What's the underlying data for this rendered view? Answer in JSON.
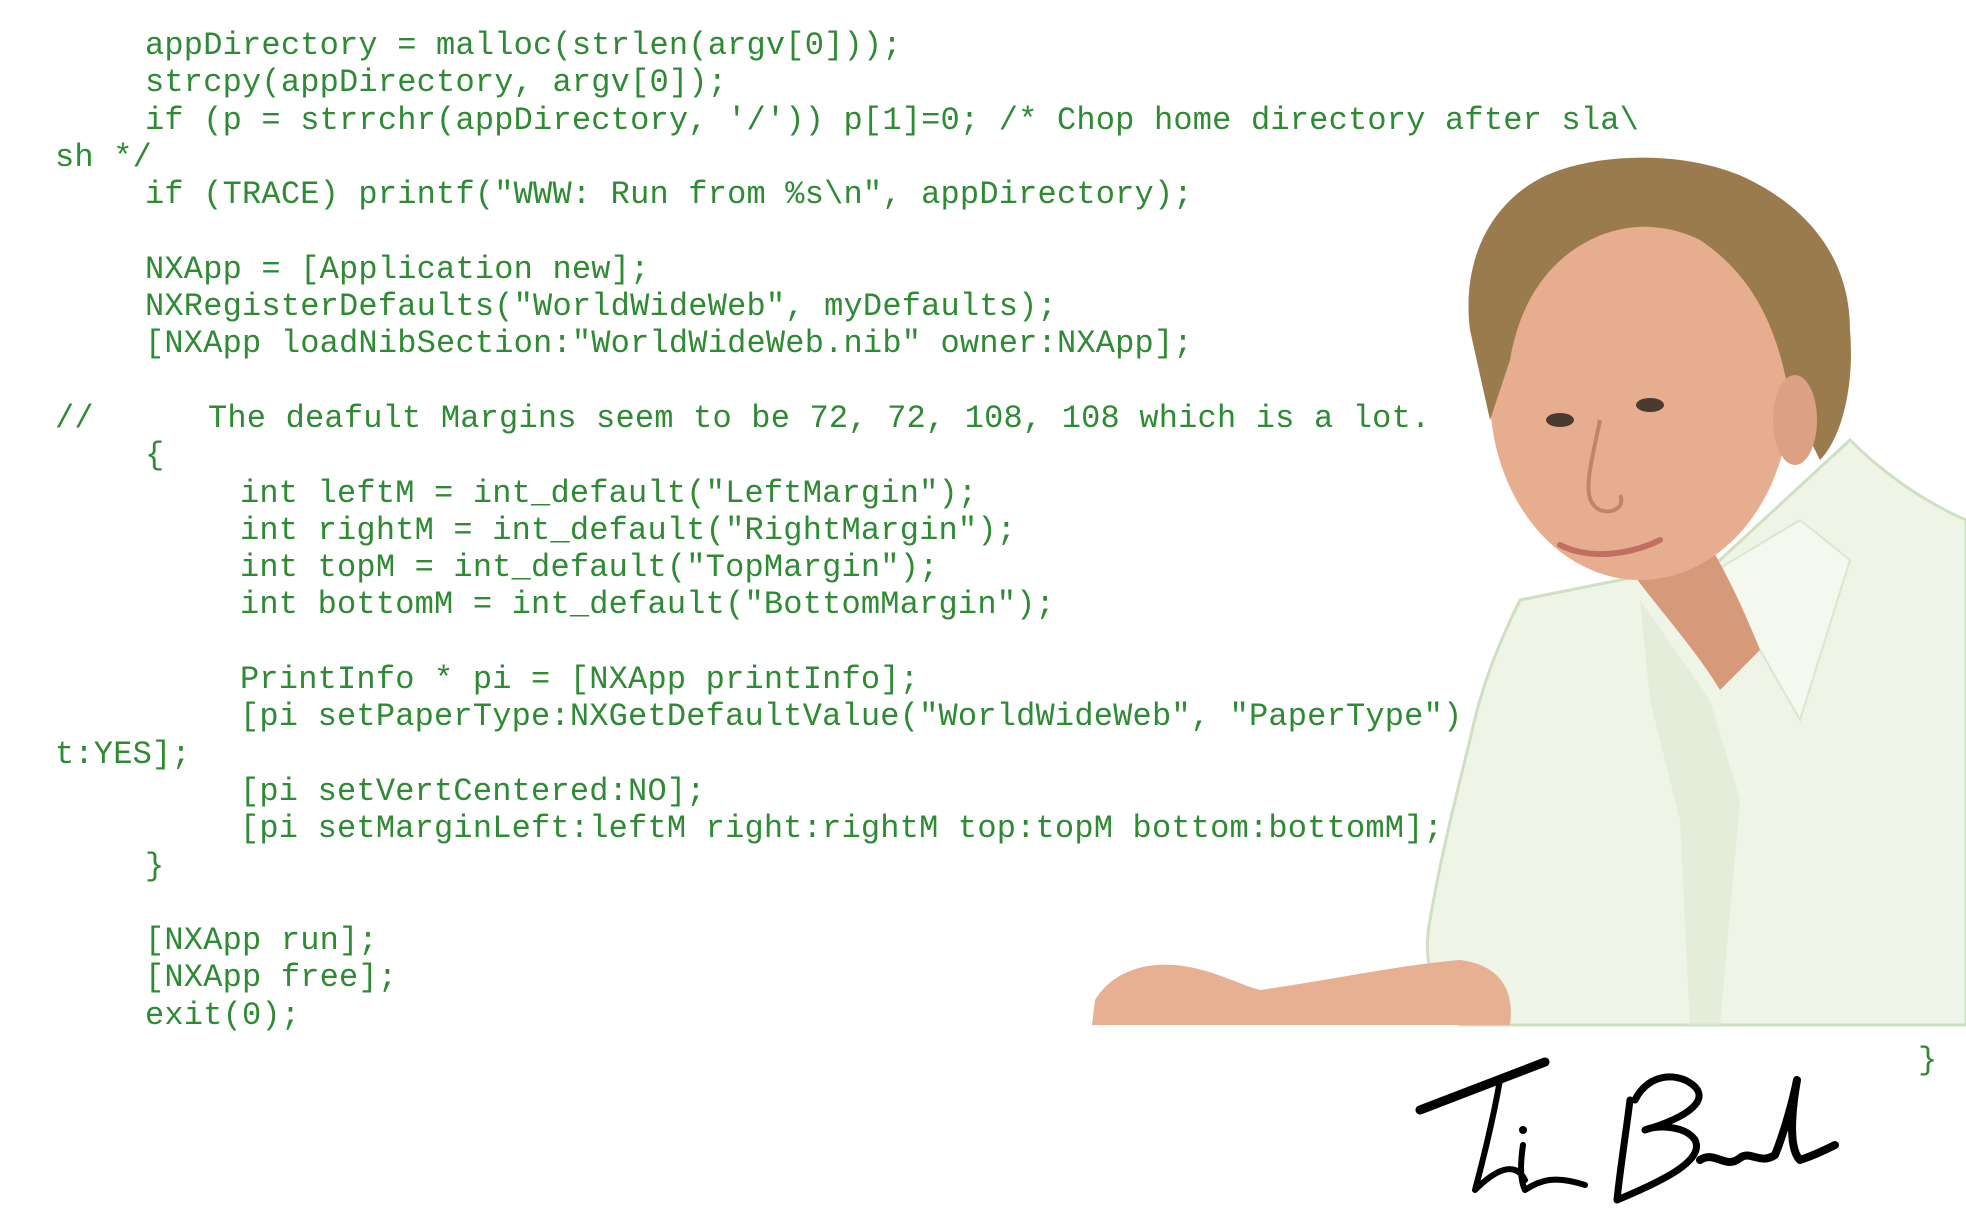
{
  "code": {
    "color": "#2f8a34",
    "lines": [
      {
        "indent": "i1",
        "text": "appDirectory = malloc(strlen(argv[0]));"
      },
      {
        "indent": "i1",
        "text": "strcpy(appDirectory, argv[0]);"
      },
      {
        "indent": "i1",
        "text": "if (p = strrchr(appDirectory, '/')) p[1]=0; /* Chop home directory after sla\\"
      },
      {
        "indent": "i0",
        "text": "sh */"
      },
      {
        "indent": "i1",
        "text": "if (TRACE) printf(\"WWW: Run from %s\\n\", appDirectory);"
      },
      {
        "indent": "i1",
        "text": ""
      },
      {
        "indent": "i1",
        "text": "NXApp = [Application new];"
      },
      {
        "indent": "i1",
        "text": "NXRegisterDefaults(\"WorldWideWeb\", myDefaults);"
      },
      {
        "indent": "i1",
        "text": "[NXApp loadNibSection:\"WorldWideWeb.nib\" owner:NXApp];"
      },
      {
        "indent": "i1",
        "text": ""
      },
      {
        "indent": "i0",
        "text": "//",
        "extra": "The deafult Margins seem to be 72, 72, 108, 108 which is a lot."
      },
      {
        "indent": "i1",
        "text": "{"
      },
      {
        "indent": "i2",
        "text": "int leftM = int_default(\"LeftMargin\");"
      },
      {
        "indent": "i2",
        "text": "int rightM = int_default(\"RightMargin\");"
      },
      {
        "indent": "i2",
        "text": "int topM = int_default(\"TopMargin\");"
      },
      {
        "indent": "i2",
        "text": "int bottomM = int_default(\"BottomMargin\");"
      },
      {
        "indent": "i2",
        "text": ""
      },
      {
        "indent": "i2",
        "text": "PrintInfo * pi = [NXApp printInfo];"
      },
      {
        "indent": "i2",
        "text": "[pi setPaperType:NXGetDefaultValue(\"WorldWideWeb\", \"PaperType\") a"
      },
      {
        "indent": "i0",
        "text": "t:YES];"
      },
      {
        "indent": "i2",
        "text": "[pi setVertCentered:NO];"
      },
      {
        "indent": "i2",
        "text": "[pi setMarginLeft:leftM right:rightM top:topM bottom:bottomM];"
      },
      {
        "indent": "i1",
        "text": "}"
      },
      {
        "indent": "i1",
        "text": ""
      },
      {
        "indent": "i1",
        "text": "[NXApp run];"
      },
      {
        "indent": "i1",
        "text": "[NXApp free];"
      },
      {
        "indent": "i1",
        "text": "exit(0);"
      }
    ],
    "closing_brace": "}"
  },
  "photo": {
    "subject": "portrait-photo",
    "skin": "#e2a98c",
    "skin_shade": "#c98a6e",
    "hair": "#9a7b4d",
    "shirt": "#eef4e6",
    "shirt_shade": "#d9e6cf"
  },
  "signature": {
    "text": "Tim Berners-Lee",
    "color": "#000000"
  }
}
